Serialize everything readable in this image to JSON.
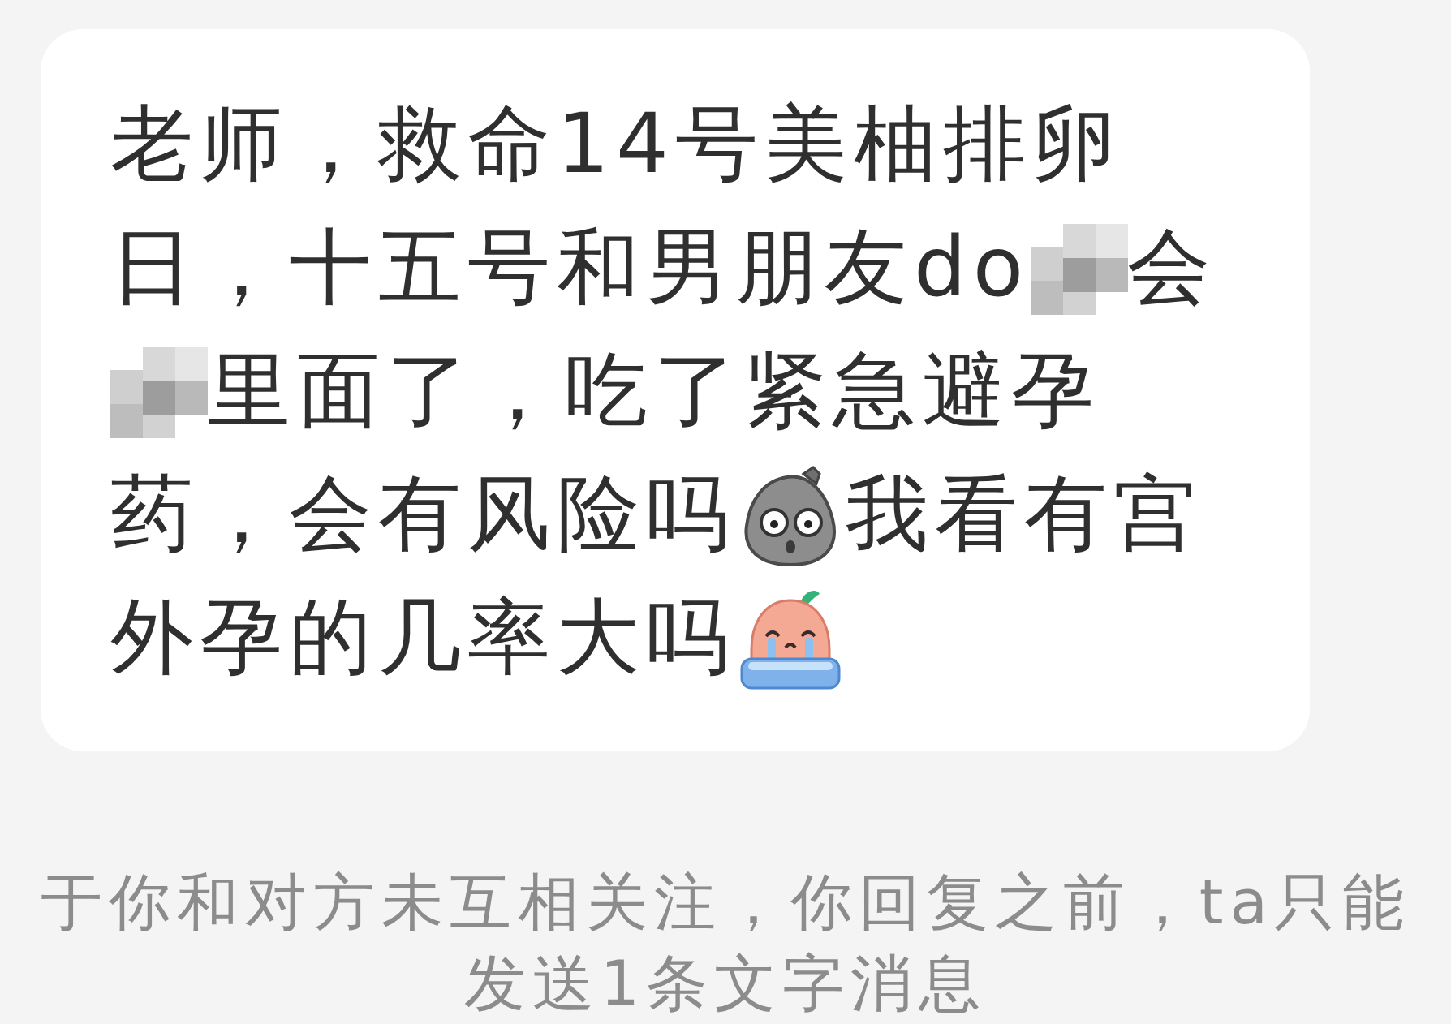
{
  "message": {
    "lines": [
      [
        {
          "kind": "text",
          "text": "老师，救命14号美柚排卵"
        }
      ],
      [
        {
          "kind": "text",
          "text": "日，十五号和男朋友do"
        },
        {
          "kind": "mosaic"
        },
        {
          "kind": "text",
          "text": "会"
        }
      ],
      [
        {
          "kind": "mosaic"
        },
        {
          "kind": "text",
          "text": "里面了，吃了紧急避孕"
        }
      ],
      [
        {
          "kind": "text",
          "text": "药，会有风险吗"
        },
        {
          "kind": "rock"
        },
        {
          "kind": "text",
          "text": "我看有宫"
        }
      ],
      [
        {
          "kind": "text",
          "text": "外孕的几率大吗"
        },
        {
          "kind": "peach"
        }
      ]
    ]
  },
  "notice": {
    "text": "于你和对方未互相关注，你回复之前，ta只能发送1条文字消息"
  }
}
